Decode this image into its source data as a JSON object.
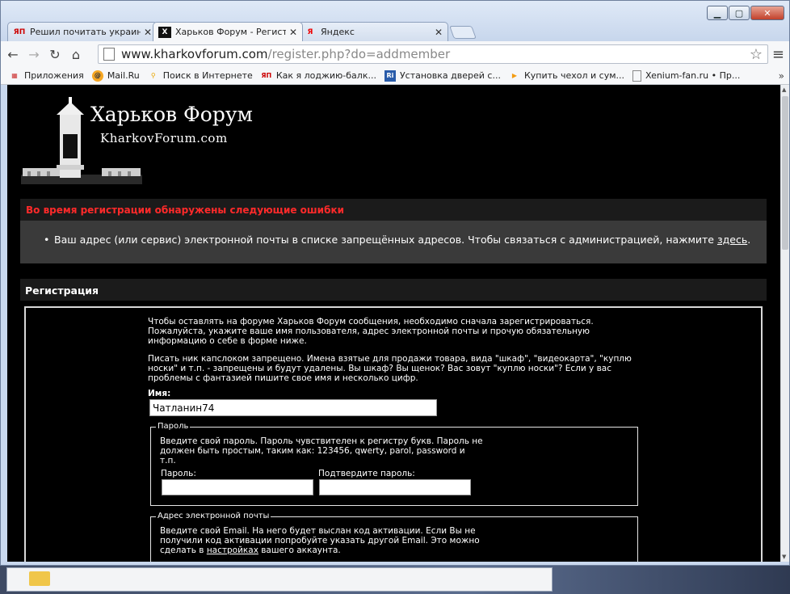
{
  "browser": {
    "tabs": [
      {
        "favicon": "ЯП",
        "title": "Решил почитать украинс"
      },
      {
        "favicon": "Х",
        "title": "Харьков Форум - Регистр"
      },
      {
        "favicon": "Я",
        "title": "Яндекс"
      }
    ],
    "url_host": "www.kharkovforum.com",
    "url_path": "/register.php?do=addmember",
    "bookmarks": [
      {
        "icon": "apps-icon",
        "label": "Приложения"
      },
      {
        "icon": "mailru-icon",
        "label": "Mail.Ru"
      },
      {
        "icon": "search-icon",
        "label": "Поиск в Интернете"
      },
      {
        "icon": "yap-icon",
        "label": "Как я лоджию-балк..."
      },
      {
        "icon": "ri-icon",
        "label": "Установка дверей с..."
      },
      {
        "icon": "play-icon",
        "label": "Купить чехол и сум..."
      },
      {
        "icon": "page-icon",
        "label": "Xenium-fan.ru • Пр..."
      }
    ],
    "bookmarks_more": "»"
  },
  "logo": {
    "title": "Харьков Форум",
    "subtitle": "KharkovForum.com"
  },
  "error": {
    "heading": "Во время регистрации обнаружены следующие ошибки",
    "message": "Ваш адрес (или сервис) электронной почты в списке запрещённых адресов. Чтобы связаться с администрацией, нажмите ",
    "link": "здесь",
    "message_end": "."
  },
  "registration": {
    "heading": "Регистрация",
    "intro_1": "Чтобы оставлять на форуме Харьков Форум сообщения, необходимо сначала зарегистрироваться. Пожалуйста, укажите ваше имя пользователя, адрес электронной почты и прочую обязательную информацию о себе в форме ниже.",
    "intro_2": "Писать ник капслоком запрещено. Имена взятые для продажи товара, вида \"шкаф\", \"видеокарта\", \"куплю носки\" и т.п. - запрещены и будут удалены. Вы шкаф? Вы щенок? Вас зовут \"куплю носки\"? Если у вас проблемы с фантазией пишите свое имя и несколько цифр.",
    "name_label": "Имя:",
    "name_value": "Чатланин74",
    "password": {
      "legend": "Пароль",
      "text": "Введите свой пароль. Пароль чувствителен к регистру букв. Пароль не должен быть простым, таким как: 123456, qwerty, parol, password и т.п.",
      "label": "Пароль:",
      "confirm_label": "Подтвердите пароль:"
    },
    "email": {
      "legend": "Адрес электронной почты",
      "text": "Введите свой Email. На него будет выслан код активации. Если Вы не получили код активации попробуйте указать другой Email. Это можно сделать в ",
      "link": "настройках",
      "text_end": " вашего аккаунта."
    }
  }
}
